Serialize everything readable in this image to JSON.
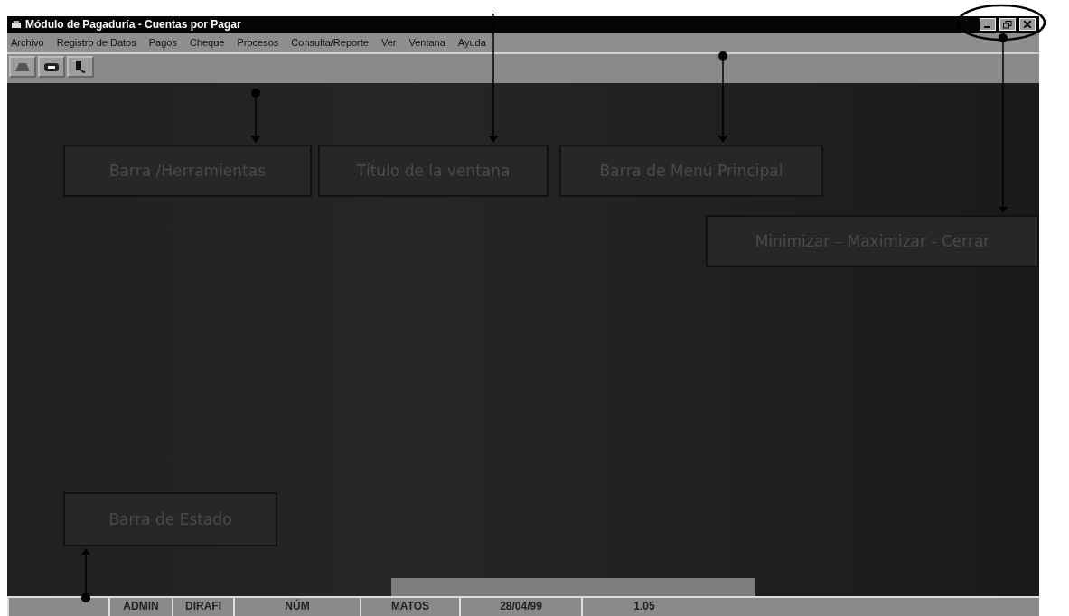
{
  "window": {
    "title": "Módulo de Pagaduría - Cuentas por Pagar"
  },
  "menu": [
    {
      "label": "Archivo"
    },
    {
      "label": "Registro de Datos"
    },
    {
      "label": "Pagos"
    },
    {
      "label": "Cheque"
    },
    {
      "label": "Procesos"
    },
    {
      "label": "Consulta/Reporte"
    },
    {
      "label": "Ver"
    },
    {
      "label": "Ventana"
    },
    {
      "label": "Ayuda"
    }
  ],
  "status_bar": [
    "ADMIN",
    "DIRAFI",
    "NÚM",
    "MATOS",
    "28/04/99",
    "1.05"
  ],
  "annotations": [
    {
      "label": "Barra /Herramientas"
    },
    {
      "label": "Título de la ventana"
    },
    {
      "label": "Barra de Menú Principal"
    },
    {
      "label": "Minimizar – Maximizar - Cerrar"
    },
    {
      "label": "Barra de Estado"
    }
  ]
}
